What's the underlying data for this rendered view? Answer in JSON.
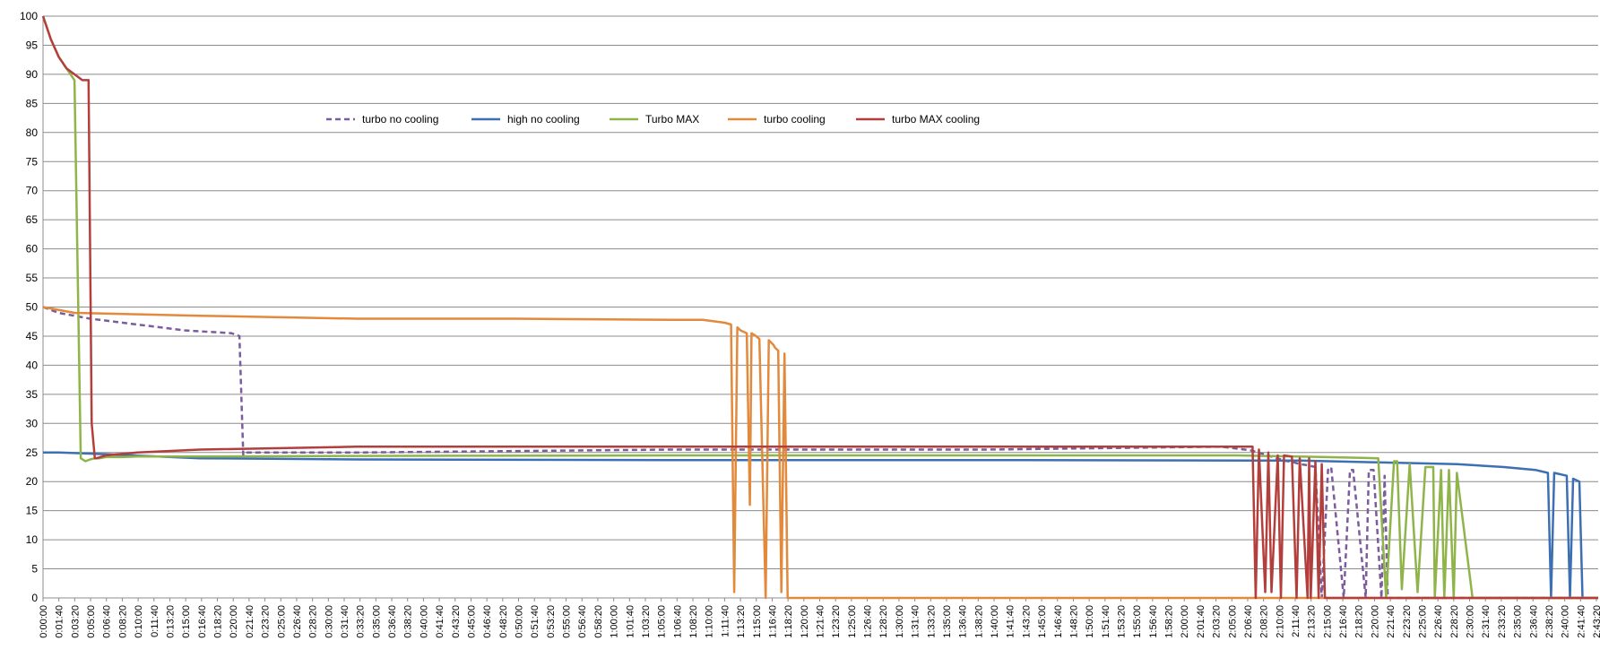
{
  "chart_data": {
    "type": "line",
    "title": "",
    "xlabel": "",
    "ylabel": "",
    "ylim": [
      0,
      100
    ],
    "yticks": [
      0,
      5,
      10,
      15,
      20,
      25,
      30,
      35,
      40,
      45,
      50,
      55,
      60,
      65,
      70,
      75,
      80,
      85,
      90,
      95,
      100
    ],
    "grid": true,
    "legend": "top-left",
    "x_tick_labels": [
      "0:00:00",
      "0:01:40",
      "0:03:20",
      "0:05:00",
      "0:06:40",
      "0:08:20",
      "0:10:00",
      "0:11:40",
      "0:13:20",
      "0:15:00",
      "0:16:40",
      "0:18:20",
      "0:20:00",
      "0:21:40",
      "0:23:20",
      "0:25:00",
      "0:26:40",
      "0:28:20",
      "0:30:00",
      "0:31:40",
      "0:33:20",
      "0:35:00",
      "0:36:40",
      "0:38:20",
      "0:40:00",
      "0:41:40",
      "0:43:20",
      "0:45:00",
      "0:46:40",
      "0:48:20",
      "0:50:00",
      "0:51:40",
      "0:53:20",
      "0:55:00",
      "0:56:40",
      "0:58:20",
      "1:00:00",
      "1:01:40",
      "1:03:20",
      "1:05:00",
      "1:06:40",
      "1:08:20",
      "1:10:00",
      "1:11:40",
      "1:13:20",
      "1:15:00",
      "1:16:40",
      "1:18:20",
      "1:20:00",
      "1:21:40",
      "1:23:20",
      "1:25:00",
      "1:26:40",
      "1:28:20",
      "1:30:00",
      "1:31:40",
      "1:33:20",
      "1:35:00",
      "1:36:40",
      "1:38:20",
      "1:40:00",
      "1:41:40",
      "1:43:20",
      "1:45:00",
      "1:46:40",
      "1:48:20",
      "1:50:00",
      "1:51:40",
      "1:53:20",
      "1:55:00",
      "1:56:40",
      "1:58:20",
      "2:00:00",
      "2:01:40",
      "2:03:20",
      "2:05:00",
      "2:06:40",
      "2:08:20",
      "2:10:00",
      "2:11:40",
      "2:13:20",
      "2:15:00",
      "2:16:40",
      "2:18:20",
      "2:20:00",
      "2:21:40",
      "2:23:20",
      "2:25:00",
      "2:26:40",
      "2:28:20",
      "2:30:00",
      "2:31:40",
      "2:33:20",
      "2:35:00",
      "2:36:40",
      "2:38:20",
      "2:40:00",
      "2:41:40",
      "2:43:20"
    ],
    "x_max_seconds": 9900,
    "series": [
      {
        "name": "turbo no cooling",
        "color": "#7b5c9d",
        "dashed": true,
        "x": [
          0,
          100,
          300,
          600,
          900,
          1200,
          1250,
          1275,
          1300,
          2000,
          4000,
          6000,
          7500,
          7650,
          7700,
          7730,
          7760,
          7790,
          7800,
          7820,
          7850,
          7880,
          7900,
          7950,
          8000,
          8050,
          8100,
          8140,
          8180,
          8200,
          8280,
          8320,
          8340,
          8420,
          8440,
          8470,
          8520,
          8540,
          8560,
          9900
        ],
        "y": [
          50,
          49,
          48,
          47,
          46,
          45.5,
          45,
          24.5,
          25,
          25,
          25.5,
          25.5,
          26,
          25.5,
          25.3,
          25,
          24.8,
          24.6,
          24.5,
          24.3,
          24,
          23.8,
          23.6,
          23.4,
          23,
          22.8,
          22.5,
          0,
          22,
          22.5,
          0,
          22,
          22,
          0,
          22,
          22,
          0,
          21,
          0,
          0
        ]
      },
      {
        "name": "high no cooling",
        "color": "#3d6fb4",
        "dashed": false,
        "x": [
          0,
          100,
          300,
          1000,
          2000,
          4000,
          6000,
          8000,
          8500,
          9000,
          9300,
          9500,
          9580,
          9600,
          9620,
          9700,
          9720,
          9740,
          9780,
          9800,
          9820,
          9900
        ],
        "y": [
          25,
          25,
          24.8,
          24,
          23.8,
          23.7,
          23.7,
          23.6,
          23.3,
          23,
          22.5,
          22,
          21.5,
          0,
          21.5,
          21,
          0,
          20.5,
          20,
          0,
          0,
          0
        ]
      },
      {
        "name": "Turbo MAX",
        "color": "#8fb44a",
        "dashed": false,
        "x": [
          0,
          50,
          100,
          150,
          200,
          240,
          270,
          300,
          330,
          360,
          400,
          500,
          600,
          800,
          1000,
          2000,
          4000,
          6000,
          7600,
          8000,
          8500,
          8550,
          8600,
          8620,
          8650,
          8700,
          8750,
          8800,
          8850,
          8860,
          8900,
          8920,
          8950,
          8980,
          9000,
          9100,
          9150,
          9200,
          9250,
          9300,
          9350,
          9500,
          9900
        ],
        "y": [
          100,
          96,
          93,
          91,
          89,
          24,
          23.5,
          23.8,
          24,
          24,
          24.2,
          24.2,
          24.3,
          24.3,
          24.3,
          24.4,
          24.5,
          24.5,
          24.5,
          24.3,
          24,
          0,
          23.5,
          23.5,
          1.5,
          23,
          1,
          22.5,
          22.5,
          0,
          22,
          0,
          22,
          0,
          21.5,
          0,
          0,
          0,
          0,
          0,
          0,
          0,
          0
        ]
      },
      {
        "name": "turbo cooling",
        "color": "#e2893b",
        "dashed": false,
        "x": [
          0,
          200,
          1000,
          2000,
          3000,
          4000,
          4200,
          4340,
          4380,
          4400,
          4420,
          4440,
          4480,
          4500,
          4510,
          4540,
          4560,
          4600,
          4620,
          4650,
          4660,
          4680,
          4700,
          4720,
          4740,
          4760,
          4800,
          4850,
          9900
        ],
        "y": [
          50,
          49,
          48.5,
          48,
          48,
          47.8,
          47.8,
          47.3,
          47,
          1,
          46.5,
          46,
          45.5,
          16,
          45.5,
          45,
          44.5,
          0,
          44.3,
          43.5,
          43,
          42.5,
          1,
          42,
          0,
          0,
          0,
          0,
          0
        ]
      },
      {
        "name": "turbo MAX cooling",
        "color": "#b33f3d",
        "dashed": false,
        "x": [
          0,
          50,
          100,
          150,
          200,
          250,
          290,
          310,
          330,
          340,
          400,
          600,
          1000,
          2000,
          4000,
          6000,
          7600,
          7700,
          7720,
          7740,
          7780,
          7800,
          7820,
          7860,
          7880,
          7900,
          7950,
          7980,
          8000,
          8050,
          8060,
          8070,
          8100,
          8120,
          8140,
          8160,
          8180,
          9900
        ],
        "y": [
          100,
          96,
          93,
          91,
          90,
          89,
          89,
          30,
          24,
          24,
          24.5,
          25,
          25.5,
          26,
          26,
          26,
          26,
          26,
          0,
          25.5,
          1,
          25,
          1,
          24.5,
          0,
          24.5,
          24.3,
          0,
          24,
          0,
          24,
          0,
          23.5,
          0,
          23,
          0,
          0,
          0
        ]
      }
    ]
  }
}
